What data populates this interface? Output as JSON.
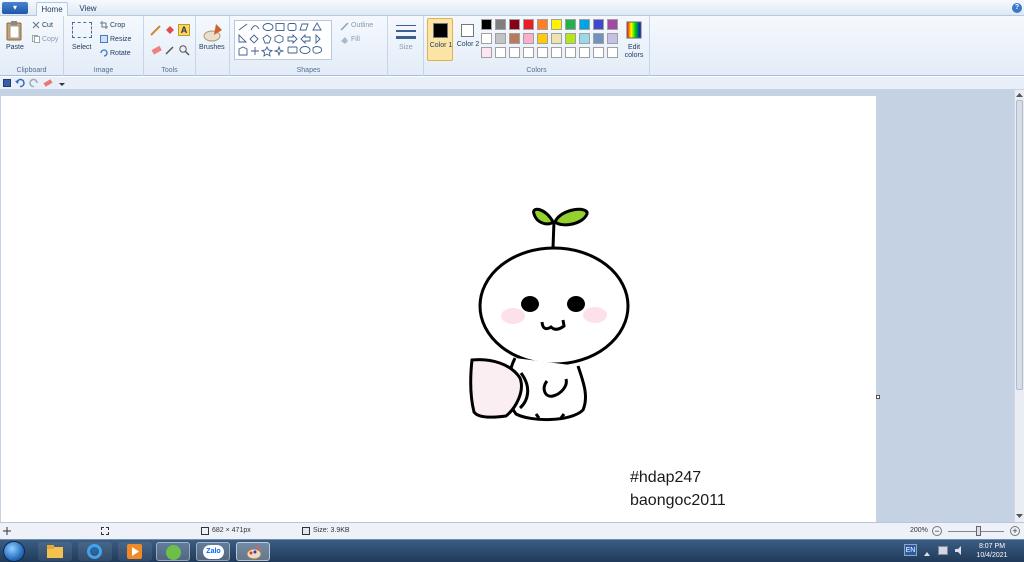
{
  "tabs": {
    "menu_label": "▾",
    "home": "Home",
    "view": "View",
    "help": "?"
  },
  "clipboard": {
    "paste": "Paste",
    "cut": "Cut",
    "copy": "Copy",
    "group": "Clipboard"
  },
  "image": {
    "select": "Select",
    "crop": "Crop",
    "resize": "Resize",
    "rotate": "Rotate",
    "group": "Image"
  },
  "tools": {
    "group": "Tools",
    "brushes": "Brushes"
  },
  "shapes": {
    "outline": "Outline",
    "fill": "Fill",
    "group": "Shapes",
    "size": "Size"
  },
  "colors": {
    "color1": "Color 1",
    "color2": "Color 2",
    "edit": "Edit colors",
    "group": "Colors",
    "color1_value": "#000000",
    "color2_value": "#ffffff",
    "palette": [
      "#000000",
      "#7f7f7f",
      "#880015",
      "#ed1c24",
      "#ff7f27",
      "#fff200",
      "#22b14c",
      "#00a2e8",
      "#3f48cc",
      "#a349a4",
      "#ffffff",
      "#c3c3c3",
      "#b97a57",
      "#ffaec9",
      "#ffc90e",
      "#efe4b0",
      "#b5e61d",
      "#99d9ea",
      "#7092be",
      "#c8bfe7",
      "#fde6f0",
      "#ffffff",
      "#ffffff",
      "#ffffff",
      "#ffffff",
      "#ffffff",
      "#ffffff",
      "#ffffff",
      "#ffffff",
      "#ffffff"
    ]
  },
  "canvas": {
    "text_line1": "#hdap247",
    "text_line2": "baongoc2011"
  },
  "status": {
    "dimensions": "682 × 471px",
    "size": "Size: 3.9KB",
    "zoom": "200%"
  },
  "taskbar": {
    "zalo": "Zalo",
    "lang": "EN",
    "time": "8:07 PM",
    "date": "10/4/2021"
  }
}
